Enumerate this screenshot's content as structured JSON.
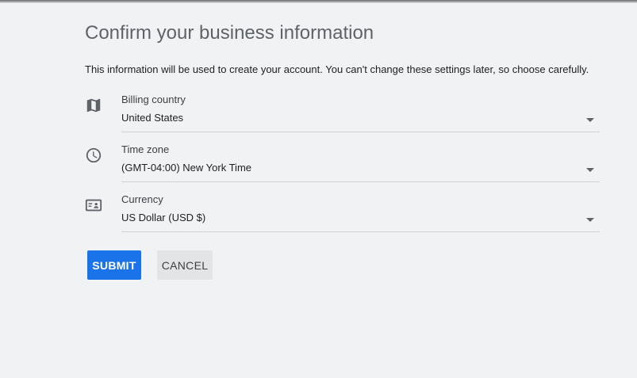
{
  "page": {
    "title": "Confirm your business information",
    "description": "This information will be used to create your account. You can't change these settings later, so choose carefully."
  },
  "fields": [
    {
      "icon": "map-icon",
      "label": "Billing country",
      "value": "United States"
    },
    {
      "icon": "clock-icon",
      "label": "Time zone",
      "value": "(GMT-04:00) New York Time"
    },
    {
      "icon": "currency-id-card-icon",
      "label": "Currency",
      "value": "US Dollar (USD $)"
    }
  ],
  "actions": {
    "submit_label": "SUBMIT",
    "cancel_label": "CANCEL"
  },
  "colors": {
    "primary": "#1a73e8",
    "background": "#f1f2f4",
    "title_gray": "#5f6368"
  }
}
